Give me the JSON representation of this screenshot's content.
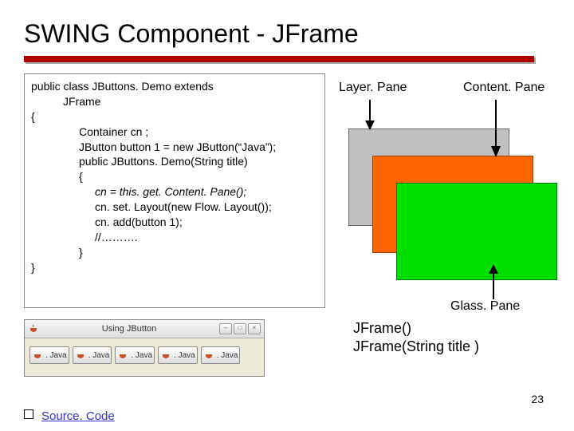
{
  "title": "SWING Component - JFrame",
  "code": {
    "l1": "public class JButtons. Demo extends",
    "l2": "JFrame",
    "l3": "{",
    "l4": "Container cn ;",
    "l5": "JButton button 1 = new JButton(“Java”);",
    "l6": "public JButtons. Demo(String title)",
    "l7": "{",
    "l8": "cn = this. get. Content. Pane();",
    "l9": "cn. set. Layout(new Flow. Layout());",
    "l10": "cn. add(button 1);",
    "l11": "//……….",
    "l12": "}",
    "l13": "}"
  },
  "panes": {
    "layer_label": "Layer. Pane",
    "content_label": "Content. Pane",
    "glass_label": "Glass. Pane"
  },
  "ctors": {
    "line1": "JFrame()",
    "line2": "JFrame(String title )"
  },
  "window": {
    "title": "Using JButton",
    "btn_label": ". Java"
  },
  "page_number": "23",
  "source": "Source. Code",
  "colors": {
    "title_rule": "#b00000",
    "gray": "#c0c0c0",
    "orange": "#ff6600",
    "green": "#00e000"
  }
}
